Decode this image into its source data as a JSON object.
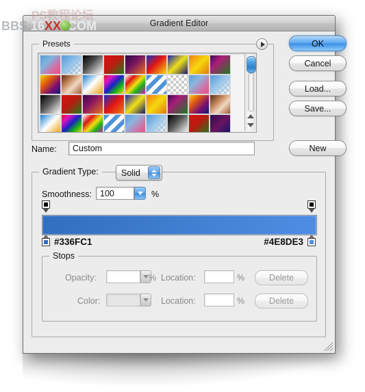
{
  "watermark": {
    "cn_text": "PS教程论坛",
    "bbs": "BBS.",
    "num16": "16",
    "xx": "XX",
    "eight": "8",
    "com": "COM"
  },
  "window": {
    "title": "Gradient Editor"
  },
  "presets": {
    "label": "Presets",
    "disclosure_icon": "triangle-right-icon",
    "scrollbar": {
      "up_arrow_icon": "arrow-up-icon",
      "down_arrow_icon": "arrow-down-icon"
    },
    "swatches": [
      {
        "name": "blue-pink",
        "css": "linear-gradient(135deg,#5b9bd5 0%,#7fb4e0 35%,#d86a9e 72%,#e7518f 100%)",
        "checker": false
      },
      {
        "name": "blue-transparent",
        "css": "linear-gradient(135deg,#4f9ada 0%,#8fc0e8 45%,rgba(255,255,255,0) 100%)",
        "checker": true
      },
      {
        "name": "black-white",
        "css": "linear-gradient(135deg,#000000 0%,#4a4a4a 40%,#ffffff 100%)",
        "checker": false
      },
      {
        "name": "red-green",
        "css": "linear-gradient(135deg,#d61212 0%,#c01a10 45%,#1f7a1a 100%)",
        "checker": false
      },
      {
        "name": "purple-orange",
        "css": "linear-gradient(135deg,#2b0a4a 0%,#7a1560 45%,#e8731a 100%)",
        "checker": false
      },
      {
        "name": "blue-red-yellow",
        "css": "linear-gradient(135deg,#1a2fbf 0%,#e01414 45%,#f2d712 100%)",
        "checker": false
      },
      {
        "name": "blue-yellow-navy",
        "css": "linear-gradient(135deg,#1a1fb0 0%,#f0e018 50%,#14166b 100%)",
        "checker": false
      },
      {
        "name": "orange-yellow",
        "css": "linear-gradient(135deg,#f07d10 0%,#f5d80e 50%,#e07a10 100%)",
        "checker": false
      },
      {
        "name": "purple-green",
        "css": "linear-gradient(135deg,#3d0b52 0%,#b01a7a 35%,#1e7a20 100%)",
        "checker": false
      },
      {
        "name": "yellow-purple-blue",
        "css": "linear-gradient(135deg,#f2d312 0%,#e05a10 35%,#7a1070 68%,#121a7a 100%)",
        "checker": false
      },
      {
        "name": "copper",
        "css": "linear-gradient(135deg,#5c2b14 0%,#c98a5e 35%,#f0d8c4 60%,#a05a30 100%)",
        "checker": false
      },
      {
        "name": "blue-white-orange",
        "css": "linear-gradient(135deg,#1a7fd0 0%,#ffffff 48%,#e8a010 100%)",
        "checker": false
      },
      {
        "name": "rainbow-1",
        "css": "linear-gradient(135deg,#e01414 0%,#e014c0 22%,#1a20c8 48%,#18b018 72%,#f0e012 100%)",
        "checker": false
      },
      {
        "name": "rainbow-white",
        "css": "linear-gradient(135deg,#ffffff 0%,#e01414 25%,#f0e012 50%,#18b018 70%,#d018c0 100%)",
        "checker": false
      },
      {
        "name": "blue-stripes",
        "css": "repeating-linear-gradient(135deg,#4f93d8 0px,#4f93d8 6px,#ffffff 6px,#ffffff 12px)",
        "checker": true
      },
      {
        "name": "transparent-checker",
        "css": "linear-gradient(135deg,rgba(255,255,255,0) 0%,rgba(255,255,255,0) 100%)",
        "checker": true
      },
      {
        "name": "blue-pink-2",
        "css": "linear-gradient(135deg,#5b9bd5 0%,#8ab6e0 35%,#d86a9e 75%,#e7518f 100%)",
        "checker": false
      },
      {
        "name": "blue-transparent-2",
        "css": "linear-gradient(135deg,#4f9ada 0%,#9fc8ea 48%,rgba(255,255,255,0) 100%)",
        "checker": true
      },
      {
        "name": "black-white-2",
        "css": "linear-gradient(135deg,#000000 0%,#5a5a5a 45%,#ffffff 100%)",
        "checker": false
      },
      {
        "name": "red-green-2",
        "css": "linear-gradient(135deg,#d61212 0%,#bb1a10 45%,#1f7a1a 100%)",
        "checker": false
      },
      {
        "name": "purple-orange-2",
        "css": "linear-gradient(135deg,#3a0a52 0%,#8a1560 42%,#e8731a 100%)",
        "checker": false
      },
      {
        "name": "blue-red-orange",
        "css": "linear-gradient(135deg,#1a2fbf 0%,#e01414 48%,#ef7a12 100%)",
        "checker": false
      },
      {
        "name": "blue-yellow-navy-2",
        "css": "linear-gradient(135deg,#1a1fb0 0%,#f0e018 50%,#14166b 100%)",
        "checker": false
      },
      {
        "name": "orange-yellow-2",
        "css": "linear-gradient(135deg,#f07d10 0%,#f5d80e 50%,#e07a10 100%)",
        "checker": false
      },
      {
        "name": "purple-green-2",
        "css": "linear-gradient(135deg,#3d0b52 0%,#a81a7a 35%,#1e7a20 100%)",
        "checker": false
      },
      {
        "name": "yellow-purple-blue-2",
        "css": "linear-gradient(135deg,#f2d312 0%,#e05a10 32%,#7a1070 66%,#121a7a 100%)",
        "checker": false
      },
      {
        "name": "copper-2",
        "css": "linear-gradient(135deg,#5c2b14 0%,#c98a5e 38%,#f0d8c4 62%,#a05a30 100%)",
        "checker": false
      },
      {
        "name": "blue-white-orange-2",
        "css": "linear-gradient(135deg,#1a7fd0 0%,#ffffff 48%,#e8a010 100%)",
        "checker": false
      },
      {
        "name": "rainbow-2",
        "css": "linear-gradient(135deg,#e01414 0%,#e014c0 22%,#1a20c8 48%,#18b018 72%,#f0e012 100%)",
        "checker": false
      },
      {
        "name": "rainbow-white-2",
        "css": "linear-gradient(135deg,#ffffff 0%,#e01414 28%,#f0e012 52%,#18b018 72%,#d018c0 100%)",
        "checker": true
      },
      {
        "name": "blue-stripes-2",
        "css": "repeating-linear-gradient(135deg,#4f93d8 0px,#4f93d8 6px,#ffffff 6px,#ffffff 12px)",
        "checker": true
      },
      {
        "name": "blue-pink-3",
        "css": "linear-gradient(135deg,#5b9bd5 0%,#8ab6e0 35%,#d86a9e 78%,#e7518f 100%)",
        "checker": false
      },
      {
        "name": "blue-transparent-3",
        "css": "linear-gradient(135deg,#4f9ada 0%,#9fc8ea 48%,rgba(255,255,255,0) 100%)",
        "checker": true
      },
      {
        "name": "black-white-3",
        "css": "linear-gradient(135deg,#000000 0%,#5a5a5a 45%,#ffffff 100%)",
        "checker": false
      },
      {
        "name": "red-green-3",
        "css": "linear-gradient(135deg,#d61212 0%,#bb1a10 45%,#1f7a1a 100%)",
        "checker": false
      },
      {
        "name": "purple-navy",
        "css": "linear-gradient(135deg,#2b0a4a 0%,#6a1560 50%,#14166b 100%)",
        "checker": false
      }
    ]
  },
  "buttons": {
    "ok": "OK",
    "cancel": "Cancel",
    "load": "Load...",
    "save": "Save...",
    "new": "New"
  },
  "name_row": {
    "label": "Name:",
    "value": "Custom"
  },
  "gradient_type": {
    "label": "Gradient Type:",
    "value": "Solid",
    "stepper_icon": "stepper-updown-icon"
  },
  "smoothness": {
    "label": "Smoothness:",
    "value": "100",
    "unit": "%",
    "arrow_icon": "chevron-down-icon"
  },
  "gradient": {
    "left_hex": "#336FC1",
    "right_hex": "#4E8DE3",
    "bar_css": "linear-gradient(to right,#336fc1 0%,#3b79cb 35%,#4483d5 65%,#4e8de3 100%)",
    "opacity_stop_icon": "opacity-stop-icon",
    "color_stop_icon": "color-stop-icon"
  },
  "stops": {
    "label": "Stops",
    "opacity_label": "Opacity:",
    "opacity_value": "",
    "opacity_unit": "%",
    "color_label": "Color:",
    "location_label": "Location:",
    "location1_value": "",
    "location2_value": "",
    "location_unit": "%",
    "delete_label": "Delete",
    "dropdown_icon": "chevron-down-icon"
  },
  "resize": {
    "grip_icon": "resize-grip-icon"
  }
}
